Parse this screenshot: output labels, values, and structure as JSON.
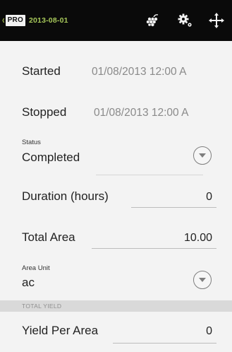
{
  "topbar": {
    "badge": "PRO",
    "title": "2013-08-01",
    "actions": [
      {
        "icon": "grapes-icon"
      },
      {
        "icon": "gear-icon"
      },
      {
        "icon": "arrows-icon"
      }
    ]
  },
  "form": {
    "started_label": "Started",
    "started_value": "01/08/2013 12:00 A",
    "stopped_label": "Stopped",
    "stopped_value": "01/08/2013 12:00 A",
    "status_label": "Status",
    "status_value": "Completed",
    "duration_label": "Duration (hours)",
    "duration_value": "0",
    "total_area_label": "Total Area",
    "total_area_value": "10.00",
    "area_unit_label": "Area Unit",
    "area_unit_value": "ac",
    "total_yield_header": "TOTAL YIELD",
    "yield_per_area_label": "Yield Per Area",
    "yield_per_area_value": "0"
  },
  "colors": {
    "topbar_bg": "#0a0a0a",
    "accent_green": "#a7c85a",
    "background": "#f3f3f3"
  }
}
